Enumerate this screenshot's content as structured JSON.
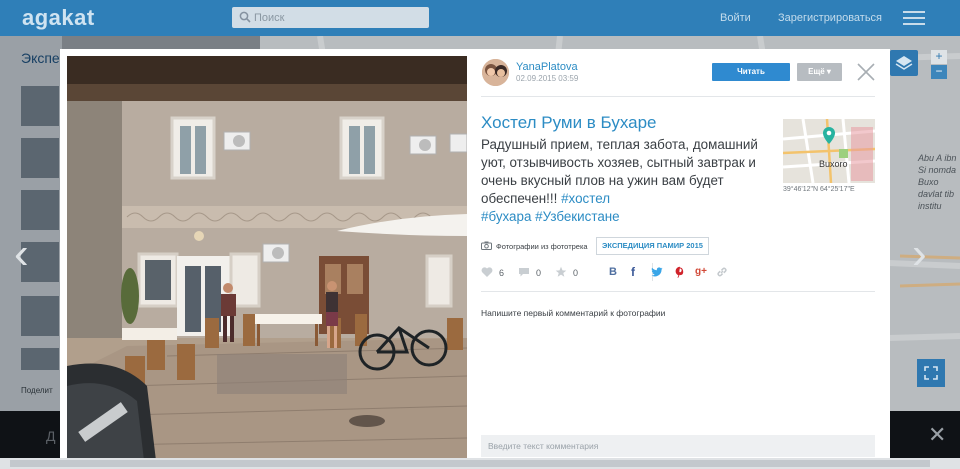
{
  "header": {
    "logo": "agakat",
    "search_placeholder": "Поиск",
    "login": "Войти",
    "register": "Зарегистрироваться"
  },
  "background": {
    "section_title": "Экспе",
    "share_label": "Поделит",
    "footer_text": "Д",
    "right_text": "Abu A ibn Si nomda Buxo davlat tib institu"
  },
  "post": {
    "author": {
      "name": "YanaPlatova",
      "date": "02.09.2015 03:59"
    },
    "buttons": {
      "read": "Читать",
      "more": "Ещё ▾"
    },
    "title": "Хостел Руми в Бухаре",
    "body_text": "Радушный прием, теплая забота, домашний уют, отзывчивость хозяев, сытный завтрак и очень вкусный плов на ужин вам будет обеспечен!!!",
    "tags": [
      "#хостел",
      "#бухара",
      "#Узбекистане"
    ],
    "map": {
      "city_label": "Buxoro",
      "coords": "39°46'12\"N 64°25'17\"E"
    },
    "tracker_label": "Фотографии из фототрека",
    "expedition": "ЭКСПЕДИЦИЯ ПАМИР 2015",
    "stats": {
      "likes": "6",
      "comments": "0",
      "stars": "0"
    },
    "comments": {
      "prompt": "Напишите первый комментарий к фотографии",
      "input_placeholder": "Введите текст комментария"
    }
  },
  "colors": {
    "brand_blue": "#2f7fb8",
    "link_blue": "#2c8cc4",
    "button_blue": "#2f8ad0"
  },
  "icons": [
    "search-icon",
    "menu-icon",
    "close-icon",
    "heart-icon",
    "comment-icon",
    "star-icon",
    "vk-icon",
    "facebook-icon",
    "twitter-icon",
    "pinterest-icon",
    "googleplus-icon",
    "link-icon",
    "camera-icon",
    "map-pin-icon",
    "layers-icon",
    "expand-icon",
    "chevron-left-icon",
    "chevron-right-icon"
  ]
}
